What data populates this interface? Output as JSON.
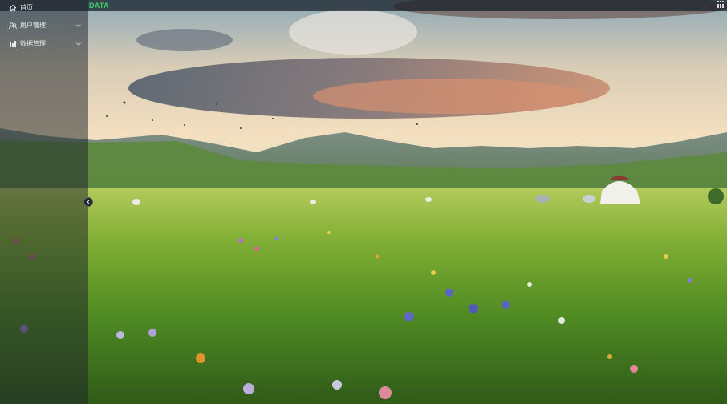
{
  "brand": "DATA",
  "menu": [
    {
      "label": "首页",
      "icon": "home-icon",
      "has_submenu": false
    },
    {
      "label": "用户管理",
      "icon": "users-icon",
      "has_submenu": true
    },
    {
      "label": "数据管理",
      "icon": "bar-chart-icon",
      "has_submenu": true
    }
  ],
  "icons": {
    "apps": "grid-apps-icon",
    "collapse": "chevron-left-icon"
  },
  "colors": {
    "brand": "#39d46a",
    "topbar": "#141c24",
    "sidebar": "#1e242a",
    "menu_text": "#e9eef2"
  }
}
